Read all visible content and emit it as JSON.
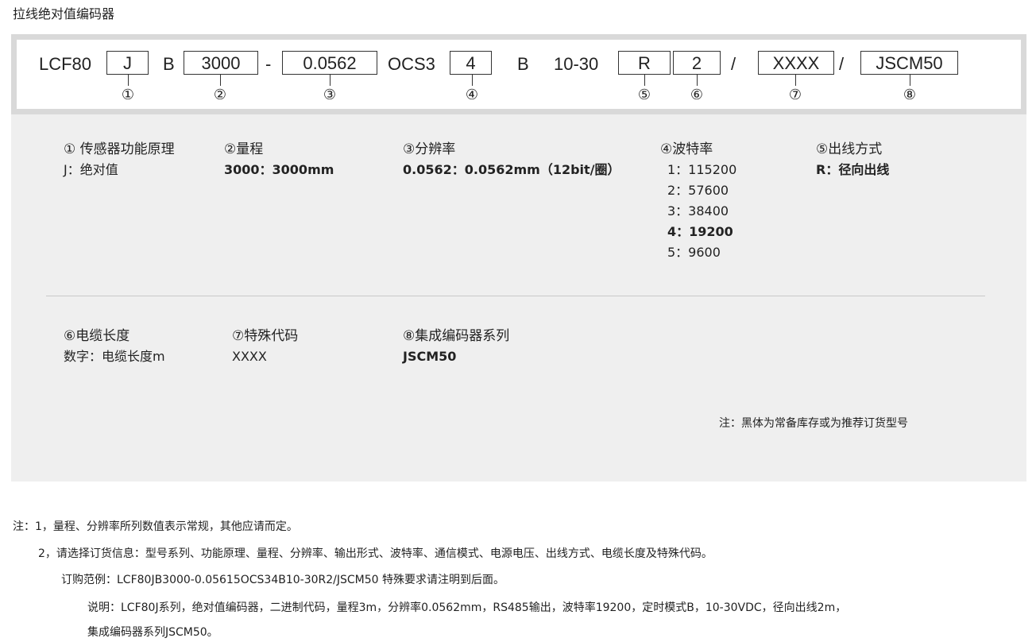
{
  "page_title": "拉线绝对值编码器",
  "code": {
    "prefix": "LCF80",
    "boxes": {
      "function": "J",
      "range": "3000",
      "resolution": "0.0562",
      "baud": "4",
      "outlet": "R",
      "cable": "2",
      "special": "XXXX",
      "series": "JSCM50"
    },
    "seps": {
      "b1": "B",
      "dash": "-",
      "ocs": "OCS3",
      "b2": "B",
      "voltage": "10-30",
      "slash1": "/",
      "slash2": "/"
    },
    "circles": [
      "①",
      "②",
      "③",
      "④",
      "⑤",
      "⑥",
      "⑦",
      "⑧"
    ]
  },
  "sections": {
    "s1": {
      "title": "① 传感器功能原理",
      "items": [
        "J：绝对值"
      ]
    },
    "s2": {
      "title": "②量程",
      "items": [
        "3000：3000mm"
      ]
    },
    "s3": {
      "title": "③分辨率",
      "items": [
        "0.0562：0.0562mm（12bit/圈）"
      ]
    },
    "s4": {
      "title": "④波特率",
      "items": [
        "1：115200",
        "2：57600",
        "3：38400",
        "4：19200",
        "5：9600"
      ]
    },
    "s5": {
      "title": "⑤出线方式",
      "items": [
        "R：径向出线"
      ]
    },
    "s6": {
      "title": "⑥电缆长度",
      "items": [
        "数字：电缆长度m"
      ]
    },
    "s7": {
      "title": "⑦特殊代码",
      "items": [
        "XXXX"
      ]
    },
    "s8": {
      "title": "⑧集成编码器系列",
      "items": [
        "JSCM50"
      ]
    }
  },
  "panel_note": "注：黑体为常备库存或为推荐订货型号",
  "notes": {
    "n1": "注：1，量程、分辨率所列数值表示常规，其他应请而定。",
    "n2": "2，请选择订货信息：型号系列、功能原理、量程、分辨率、输出形式、波特率、通信模式、电源电压、出线方式、电缆长度及特殊代码。",
    "n3": "订购范例：LCF80JB3000-0.05615OCS34B10-30R2/JSCM50 特殊要求请注明到后面。",
    "n4": "说明：LCF80J系列，绝对值编码器，二进制代码，量程3m，分辨率0.0562mm，RS485输出，波特率19200，定时模式B，10-30VDC，径向出线2m，",
    "n5": "集成编码器系列JSCM50。"
  }
}
